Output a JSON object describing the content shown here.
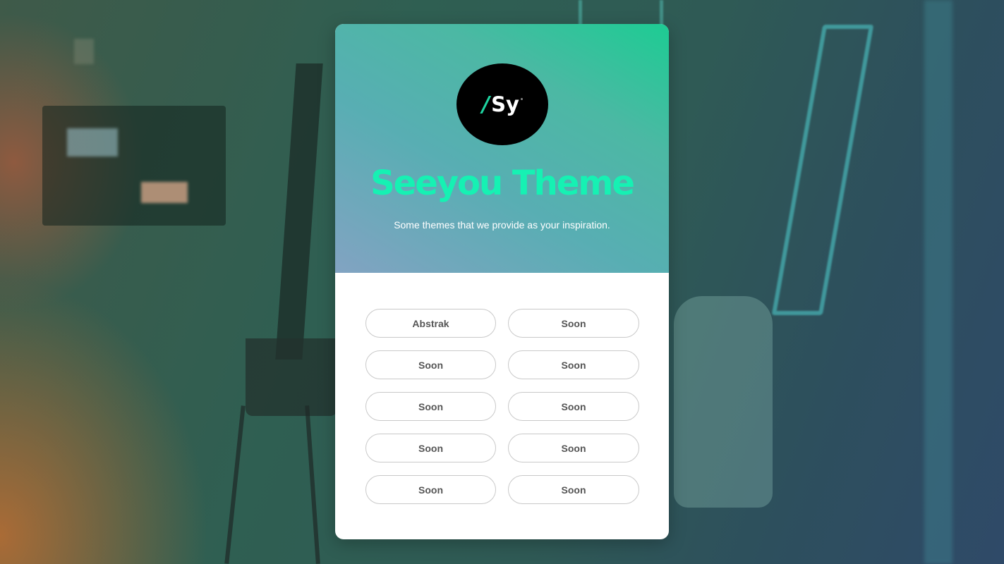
{
  "brand": {
    "logo_slash": "/",
    "logo_letters": "Sy",
    "title": "Seeyou Theme",
    "subtitle": "Some themes that we provide as your inspiration."
  },
  "colors": {
    "title": "#16f1b3",
    "logo_slash": "#1ed3a0",
    "header_gradient": [
      "#82a3c2",
      "#58aeb3",
      "#4cb8a4",
      "#1dcc93"
    ]
  },
  "themes": [
    {
      "label": "Abstrak"
    },
    {
      "label": "Soon"
    },
    {
      "label": "Soon"
    },
    {
      "label": "Soon"
    },
    {
      "label": "Soon"
    },
    {
      "label": "Soon"
    },
    {
      "label": "Soon"
    },
    {
      "label": "Soon"
    },
    {
      "label": "Soon"
    },
    {
      "label": "Soon"
    }
  ]
}
